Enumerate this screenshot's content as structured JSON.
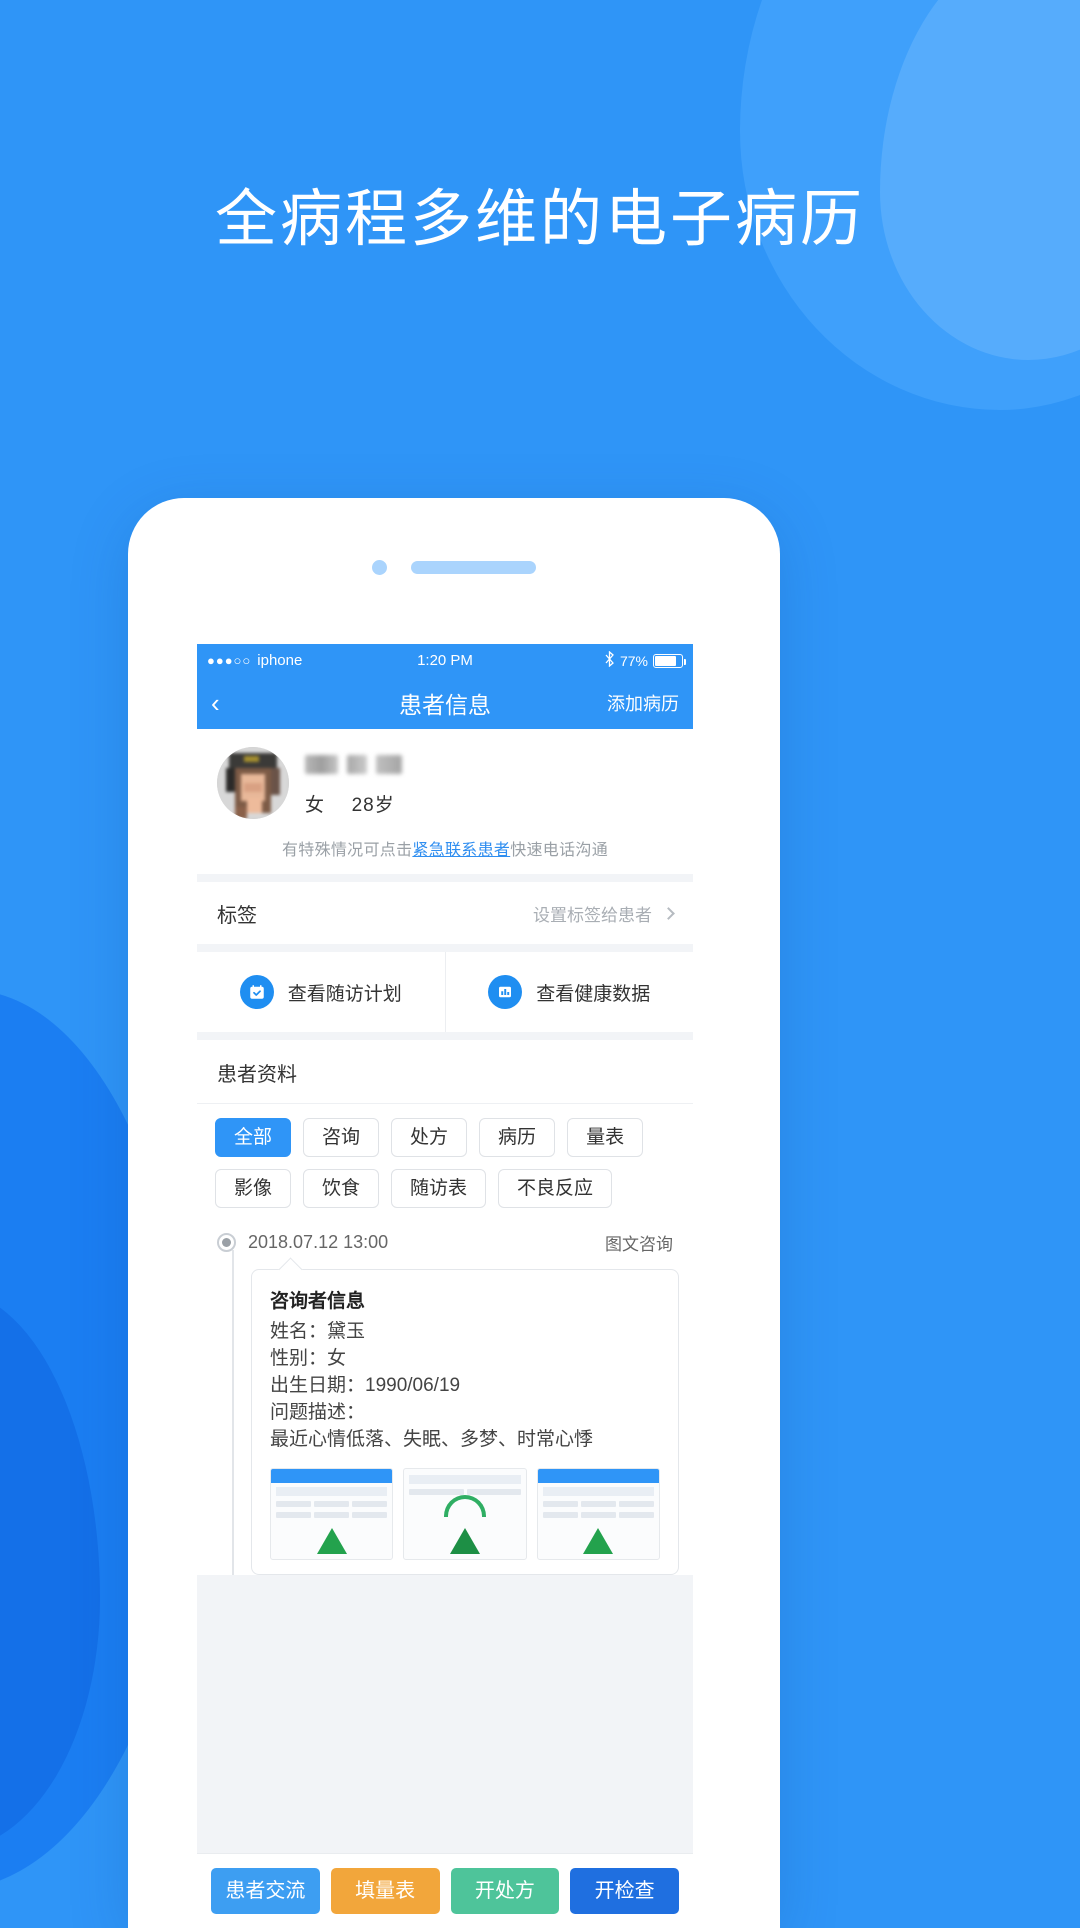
{
  "headline": "全病程多维的电子病历",
  "theme": {
    "brand_blue": "#2f95f7",
    "bg_blue": "#2f95f7",
    "link_blue": "#2f8ef0"
  },
  "phone": {
    "status_bar": {
      "signal_dots": "●●●○○",
      "carrier": "iphone",
      "time": "1:20 PM",
      "bluetooth_icon": "bluetooth-icon",
      "battery_percent": "77%"
    },
    "nav": {
      "back_icon": "chevron-left-icon",
      "title": "患者信息",
      "action": "添加病历"
    },
    "patient": {
      "avatar_icon": "avatar-blurred",
      "name_masked": "",
      "gender": "女",
      "age": "28岁",
      "emergency_prefix": "有特殊情况可点击",
      "emergency_link": "紧急联系患者",
      "emergency_suffix": "快速电话沟通"
    },
    "tag_row": {
      "label": "标签",
      "value": "设置标签给患者",
      "chevron_icon": "chevron-right-icon"
    },
    "actions": [
      {
        "icon": "calendar-check-icon",
        "label": "查看随访计划"
      },
      {
        "icon": "bar-chart-icon",
        "label": "查看健康数据"
      }
    ],
    "data_section": {
      "title": "患者资料",
      "chips": [
        {
          "label": "全部",
          "active": true
        },
        {
          "label": "咨询",
          "active": false
        },
        {
          "label": "处方",
          "active": false
        },
        {
          "label": "病历",
          "active": false
        },
        {
          "label": "量表",
          "active": false
        },
        {
          "label": "影像",
          "active": false
        },
        {
          "label": "饮食",
          "active": false
        },
        {
          "label": "随访表",
          "active": false
        },
        {
          "label": "不良反应",
          "active": false
        }
      ]
    },
    "timeline": [
      {
        "date": "2018.07.12 13:00",
        "type": "图文咨询",
        "bubble_title": "咨询者信息",
        "lines": [
          "姓名：黛玉",
          "性别：女",
          "出生日期：1990/06/19",
          "问题描述：",
          "最近心情低落、失眠、多梦、时常心悸"
        ]
      }
    ],
    "bottom_buttons": [
      {
        "label": "患者交流",
        "color": "#3d9ef2"
      },
      {
        "label": "填量表",
        "color": "#f2a63b"
      },
      {
        "label": "开处方",
        "color": "#4ec49a"
      },
      {
        "label": "开检查",
        "color": "#1f6fe0"
      }
    ]
  }
}
